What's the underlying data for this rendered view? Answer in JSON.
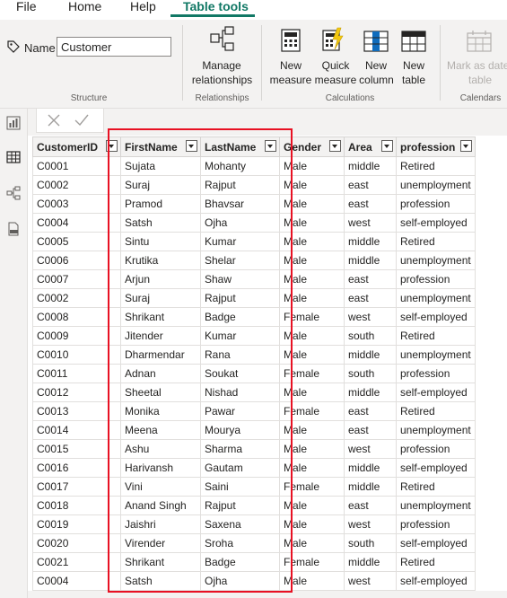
{
  "menu": {
    "file": "File",
    "home": "Home",
    "help": "Help",
    "table_tools": "Table tools"
  },
  "ribbon": {
    "name_label": "Name",
    "name_value": "Customer",
    "groups": {
      "structure": "Structure",
      "relationships": "Relationships",
      "calculations": "Calculations",
      "calendars": "Calendars"
    },
    "buttons": {
      "manage_rel_1": "Manage",
      "manage_rel_2": "relationships",
      "new_measure_1": "New",
      "new_measure_2": "measure",
      "quick_measure_1": "Quick",
      "quick_measure_2": "measure",
      "new_column_1": "New",
      "new_column_2": "column",
      "new_table_1": "New",
      "new_table_2": "table",
      "mark_date_1": "Mark as date",
      "mark_date_2": "table"
    }
  },
  "colors": {
    "accent": "#117865",
    "highlight_box": "#e81123"
  },
  "icons": {
    "rail": [
      "report-view-icon",
      "table-view-icon",
      "model-view-icon",
      "dax-query-icon"
    ],
    "formula": [
      "cancel-icon",
      "commit-icon"
    ]
  },
  "table": {
    "columns": [
      "CustomerID",
      "FirstName",
      "LastName",
      "Gender",
      "Area",
      "profession"
    ],
    "rows": [
      [
        "C0001",
        "Sujata",
        "Mohanty",
        "Male",
        "middle",
        "Retired"
      ],
      [
        "C0002",
        "Suraj",
        "Rajput",
        "Male",
        "east",
        "unemployment"
      ],
      [
        "C0003",
        "Pramod",
        "Bhavsar",
        "Male",
        "east",
        "profession"
      ],
      [
        "C0004",
        "Satsh",
        "Ojha",
        "Male",
        "west",
        "self-employed"
      ],
      [
        "C0005",
        "Sintu",
        "Kumar",
        "Male",
        "middle",
        "Retired"
      ],
      [
        "C0006",
        "Krutika",
        "Shelar",
        "Male",
        "middle",
        "unemployment"
      ],
      [
        "C0007",
        "Arjun",
        "Shaw",
        "Male",
        "east",
        "profession"
      ],
      [
        "C0002",
        "Suraj",
        "Rajput",
        "Male",
        "east",
        "unemployment"
      ],
      [
        "C0008",
        "Shrikant",
        "Badge",
        "Female",
        "west",
        "self-employed"
      ],
      [
        "C0009",
        "Jitender",
        "Kumar",
        "Male",
        "south",
        "Retired"
      ],
      [
        "C0010",
        "Dharmendar",
        "Rana",
        "Male",
        "middle",
        "unemployment"
      ],
      [
        "C0011",
        "Adnan",
        "Soukat",
        "Female",
        "south",
        "profession"
      ],
      [
        "C0012",
        "Sheetal",
        "Nishad",
        "Male",
        "middle",
        "self-employed"
      ],
      [
        "C0013",
        "Monika",
        "Pawar",
        "Female",
        "east",
        "Retired"
      ],
      [
        "C0014",
        "Meena",
        "Mourya",
        "Male",
        "east",
        "unemployment"
      ],
      [
        "C0015",
        "Ashu",
        "Sharma",
        "Male",
        "west",
        "profession"
      ],
      [
        "C0016",
        "Harivansh",
        "Gautam",
        "Male",
        "middle",
        "self-employed"
      ],
      [
        "C0017",
        "Vini",
        "Saini",
        "Female",
        "middle",
        "Retired"
      ],
      [
        "C0018",
        "Anand Singh",
        "Rajput",
        "Male",
        "east",
        "unemployment"
      ],
      [
        "C0019",
        "Jaishri",
        "Saxena",
        "Male",
        "west",
        "profession"
      ],
      [
        "C0020",
        "Virender",
        "Sroha",
        "Male",
        "south",
        "self-employed"
      ],
      [
        "C0021",
        "Shrikant",
        "Badge",
        "Female",
        "middle",
        "Retired"
      ],
      [
        "C0004",
        "Satsh",
        "Ojha",
        "Male",
        "west",
        "self-employed"
      ]
    ]
  }
}
